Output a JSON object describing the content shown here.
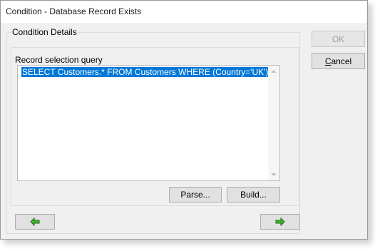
{
  "window": {
    "title": "Condition - Database Record Exists"
  },
  "group": {
    "legend": "Condition Details"
  },
  "query": {
    "label": "Record selection query",
    "value": "SELECT Customers.* FROM Customers WHERE (Country='UK')"
  },
  "buttons": {
    "parse_label": "Parse...",
    "build_label": "Build...",
    "ok_label": "OK",
    "cancel_label_prefix": "",
    "cancel_label_accel": "C",
    "cancel_label_rest": "ancel"
  },
  "nav": {
    "back_icon": "arrow-left-icon",
    "next_icon": "arrow-right-icon",
    "arrow_color": "#2e9b1f"
  },
  "colors": {
    "selection": "#0078d7"
  }
}
